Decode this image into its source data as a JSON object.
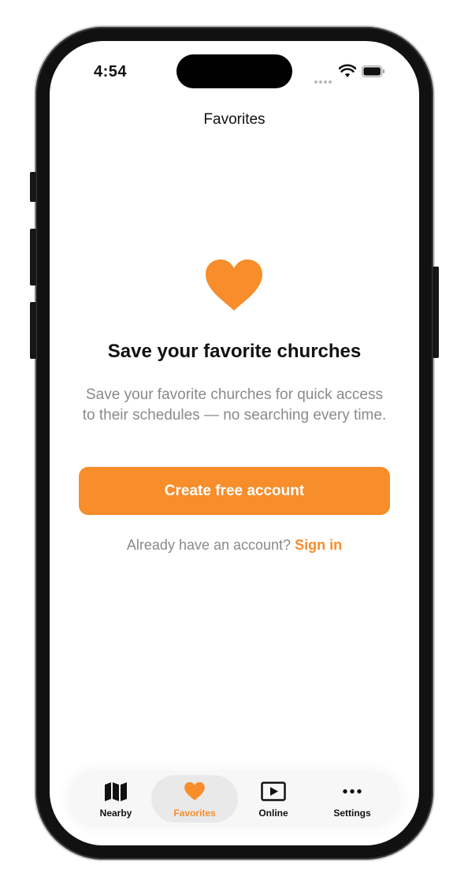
{
  "status_bar": {
    "time": "4:54"
  },
  "nav": {
    "title": "Favorites"
  },
  "empty_state": {
    "title": "Save your favorite churches",
    "description": "Save your favorite churches for quick access to their schedules — no searching every time.",
    "primary_button": "Create free account",
    "signin_prompt": "Already have an account?",
    "signin_link": "Sign in"
  },
  "tabs": [
    {
      "label": "Nearby",
      "icon": "map-icon"
    },
    {
      "label": "Favorites",
      "icon": "heart-icon",
      "selected": true
    },
    {
      "label": "Online",
      "icon": "play-icon"
    },
    {
      "label": "Settings",
      "icon": "more-icon"
    }
  ],
  "colors": {
    "accent": "#f78d2b",
    "text": "#111111",
    "secondary_text": "#8a8a8e"
  }
}
